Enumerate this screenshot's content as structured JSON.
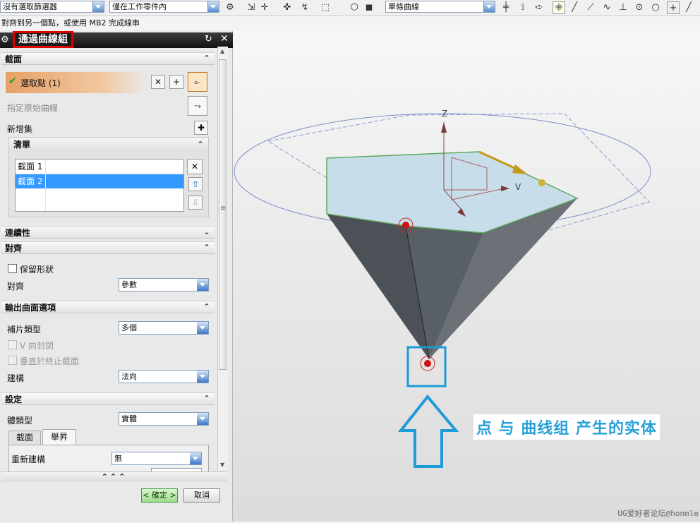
{
  "toolbar": {
    "filter_selector": "沒有選取篩選器",
    "scope_selector": "僅在工作零件內",
    "curve_rule": "單條曲線"
  },
  "status": {
    "prompt": "對齊到另一個點，或使用 MB2 完成線串"
  },
  "panel": {
    "title": "通過曲線組",
    "section": {
      "header": "截面",
      "select_points": "選取點 (1)",
      "specify_origin": "指定原始曲線",
      "add_new_set": "新增集",
      "list_header": "清單",
      "list_items": [
        "截面 1",
        "截面 2"
      ]
    },
    "continuity": {
      "header": "連續性"
    },
    "alignment": {
      "header": "對齊",
      "keep_shape": "保留形狀",
      "align_label": "對齊",
      "align_value": "參數"
    },
    "output": {
      "header": "輸出曲面選項",
      "patch_type_label": "補片類型",
      "patch_type_value": "多個",
      "v_closed": "V 向封閉",
      "normal_to_end": "垂直於終止截面",
      "construct_label": "建構",
      "construct_value": "法向"
    },
    "settings": {
      "header": "設定",
      "body_type_label": "體類型",
      "body_type_value": "實體",
      "tab1": "截面",
      "tab2": "舉昇",
      "rebuild_label": "重新建構",
      "rebuild_value": "無"
    },
    "ok": "< 確定 >",
    "cancel": "取消"
  },
  "viewport": {
    "axis_z": "Z",
    "axis_v": "V"
  },
  "annotation": {
    "text": "点 与 曲线组 产生的实体"
  },
  "watermark": "UG爱好者论坛@honmle"
}
